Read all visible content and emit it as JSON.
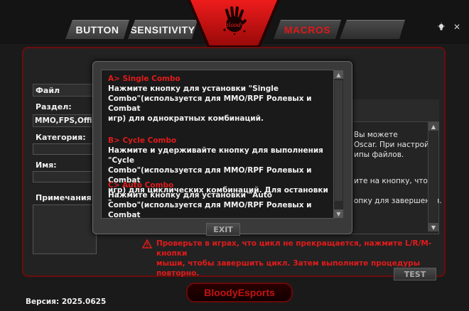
{
  "tabs": {
    "button": "BUTTON",
    "sensitivity": "SENSITIVITY",
    "macros": "MACROS",
    "blank": ""
  },
  "logo": {
    "text": "bloody"
  },
  "window": {
    "bulb_icon": "lightbulb-icon",
    "close_icon": "close-icon"
  },
  "left": {
    "file_label": "Файл",
    "section_label": "Раздел:",
    "section_value": "MMO,FPS,Office",
    "category_label": "Категория:",
    "name_label": "Имя:",
    "notes_label": "Примечания:"
  },
  "right_panel": {
    "line1": "Вы можете",
    "line2": "Oscar. При настройке",
    "line3": "ипы файлов.",
    "line4": "ите на кнопку, чтобы",
    "line5": "опку для завершения."
  },
  "modal": {
    "combos": [
      {
        "title": "A> Single Combo",
        "desc": [
          "Нажмите кнопку для установки \"Single",
          "Combo\"(используется для  MMO/RPF Ролевых  и  Combat",
          "игр) для однократных комбинаций."
        ]
      },
      {
        "title": "B> Cycle Combo",
        "desc": [
          "Нажмите и удерживайте кнопку для выполнения \"Cycle",
          "Combo\"(используется для MMO/RPF Ролевых и Combat",
          "игр) для циклических комбинаций. Для остановки –"
        ]
      },
      {
        "title": "C> Auto Combo",
        "desc": [
          "Нажмите кнопку для установки \"Auto",
          "Combo\"(используется для MMO/RPF Ролевых и Combat"
        ]
      }
    ],
    "exit_label": "EXIT"
  },
  "warning": {
    "line1": "Проверьте в играх, что цикл не прекращается, нажмите L/R/M-кнопки",
    "line2": "мыши, чтобы завершить цикл. Затем выполните процедуры повторно."
  },
  "test_label": "TEST",
  "bottom_badge": "BloodyEsports",
  "version": "Версия: 2025.0625",
  "colors": {
    "accent_red": "#e11b1b",
    "frame_red": "#6b0d0d",
    "background": "#1a1a1a"
  }
}
